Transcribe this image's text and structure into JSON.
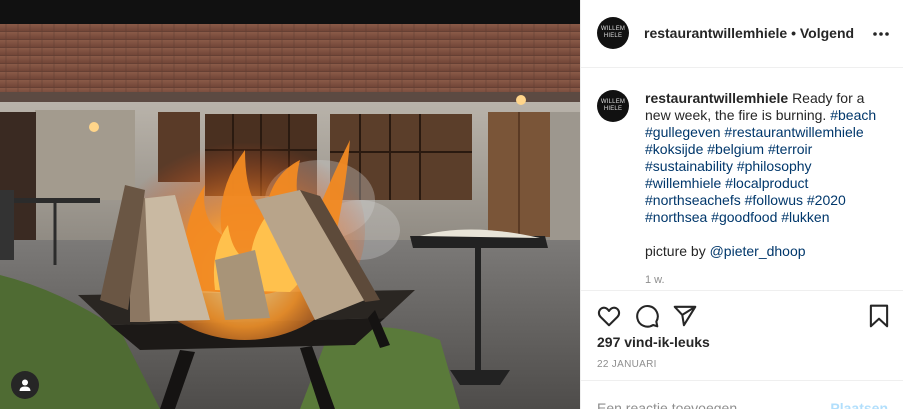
{
  "post": {
    "username": "restaurantwillemhiele",
    "avatar_text": "WILLEM HIELE",
    "separator": "•",
    "follow_label": "Volgend",
    "caption_text": "Ready for a new week, the fire is burning.",
    "hashtags": [
      "#beach",
      "#gullegeven",
      "#restaurantwillemhiele",
      "#koksijde",
      "#belgium",
      "#terroir",
      "#sustainability",
      "#philosophy",
      "#willemhiele",
      "#localproduct",
      "#northseachefs",
      "#followus",
      "#2020",
      "#northsea",
      "#goodfood",
      "#lukken"
    ],
    "credit_prefix": "picture by",
    "credit_mention": "@pieter_dhoop",
    "age": "1 w.",
    "likes": "297 vind-ik-leuks",
    "date": "22 JANUARI",
    "comment_placeholder": "Een reactie toevoegen...",
    "post_label": "Plaatsen"
  },
  "icons": {
    "more": "more-horizontal-icon",
    "like": "heart-icon",
    "comment": "comment-icon",
    "share": "send-icon",
    "save": "bookmark-icon",
    "user_tag": "user-icon"
  },
  "colors": {
    "text": "#262626",
    "secondary": "#8e8e8e",
    "link": "#00376b",
    "post_disabled": "#b2dffc"
  }
}
